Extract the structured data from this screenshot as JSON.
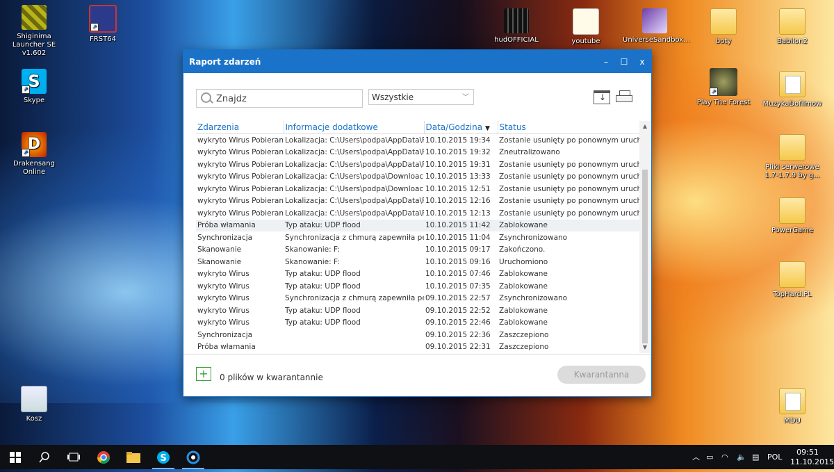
{
  "desktop": {
    "icons": [
      {
        "label": "Shiginima Launcher SE v1.602"
      },
      {
        "label": "FRST64"
      },
      {
        "label": "Skype"
      },
      {
        "label": "Drakensang Online"
      },
      {
        "label": "Kosz"
      },
      {
        "label": "hudOFFICIAL"
      },
      {
        "label": "youtube"
      },
      {
        "label": "UniverseSandbox..."
      },
      {
        "label": "boty"
      },
      {
        "label": "Babilon2"
      },
      {
        "label": "Play The Forest"
      },
      {
        "label": "MuzykaDofilmow"
      },
      {
        "label": "Pliki serwerowe 1.7-1.7.9 by g..."
      },
      {
        "label": "PowerGame"
      },
      {
        "label": "TopHard.PL"
      },
      {
        "label": "MDU"
      }
    ]
  },
  "window": {
    "title": "Raport zdarzeń",
    "controls": {
      "minimize": "–",
      "maximize": "☐",
      "close": "x"
    }
  },
  "toolbar": {
    "search_placeholder": "Znajdz",
    "filter_selected": "Wszystkie"
  },
  "table": {
    "columns": [
      "Zdarzenia",
      "Informacje dodatkowe",
      "Data/Godzina",
      "Status"
    ],
    "rows": [
      [
        "wykryto Wirus Pobieran",
        "Lokalizacja: C:\\Users\\podpa\\AppData\\F",
        "10.10.2015 19:34",
        "Zostanie usunięty po ponownym urucho"
      ],
      [
        "wykryto Wirus Pobieran",
        "Lokalizacja: C:\\Users\\podpa\\AppData\\F",
        "10.10.2015 19:32",
        "Zneutralizowano"
      ],
      [
        "wykryto Wirus Pobieran",
        "Lokalizacja: C:\\Users\\podpa\\AppData\\F",
        "10.10.2015 19:31",
        "Zostanie usunięty po ponownym urucho"
      ],
      [
        "wykryto Wirus Pobieran",
        "Lokalizacja: C:\\Users\\podpa\\Downloac",
        "10.10.2015 13:33",
        "Zostanie usunięty po ponownym urucho"
      ],
      [
        "wykryto Wirus Pobieran",
        "Lokalizacja: C:\\Users\\podpa\\Downloac",
        "10.10.2015 12:51",
        "Zostanie usunięty po ponownym urucho"
      ],
      [
        "wykryto Wirus Pobieran",
        "Lokalizacja: C:\\Users\\podpa\\AppData\\F",
        "10.10.2015 12:16",
        "Zostanie usunięty po ponownym urucho"
      ],
      [
        "wykryto Wirus Pobieran",
        "Lokalizacja: C:\\Users\\podpa\\AppData\\F",
        "10.10.2015 12:13",
        "Zostanie usunięty po ponownym urucho"
      ],
      [
        "Próba włamania",
        "Typ ataku: UDP flood",
        "10.10.2015 11:42",
        "Zablokowane"
      ],
      [
        "Synchronizacja",
        "Synchronizacja z chmurą zapewniła peł",
        "10.10.2015 11:04",
        "Zsynchronizowano"
      ],
      [
        "Skanowanie",
        "Skanowanie: F:",
        "10.10.2015 09:17",
        "Zakończono."
      ],
      [
        "Skanowanie",
        "Skanowanie: F:",
        "10.10.2015 09:16",
        "Uruchomiono"
      ],
      [
        "wykryto Wirus",
        "Typ ataku: UDP flood",
        "10.10.2015 07:46",
        "Zablokowane"
      ],
      [
        "wykryto Wirus",
        "Typ ataku: UDP flood",
        "10.10.2015 07:35",
        "Zablokowane"
      ],
      [
        "wykryto Wirus",
        "Synchronizacja z chmurą zapewniła peł",
        "09.10.2015 22:57",
        "Zsynchronizowano"
      ],
      [
        "wykryto Wirus",
        "Typ ataku: UDP flood",
        "09.10.2015 22:52",
        "Zablokowane"
      ],
      [
        "wykryto Wirus",
        "Typ ataku: UDP flood",
        "09.10.2015 22:46",
        "Zablokowane"
      ],
      [
        "Synchronizacja",
        "",
        "09.10.2015 22:36",
        "Zaszczepiono"
      ],
      [
        "Próba włamania",
        "",
        "09.10.2015 22:31",
        "Zaszczepiono"
      ]
    ]
  },
  "footer": {
    "add_symbol": "+",
    "quarantine_count": "0 plików w kwarantannie",
    "quarantine_button": "Kwarantanna"
  },
  "taskbar": {
    "language": "POL",
    "time": "09:51",
    "date": "11.10.2015"
  }
}
